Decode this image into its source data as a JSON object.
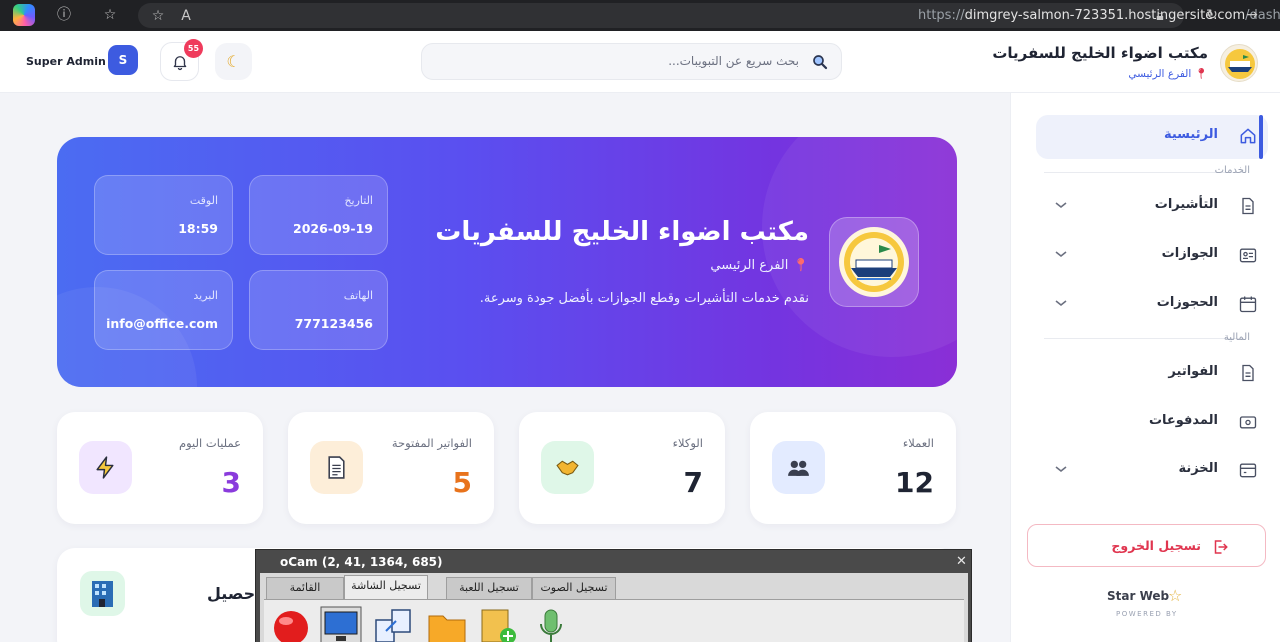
{
  "browser": {
    "url_prefix": "https://",
    "url_host": "dimgrey-salmon-723351.hostingersite.com",
    "url_path": "/dashboard"
  },
  "header": {
    "admin_name": "Super Admin",
    "avatar_letter": "S",
    "notification_count": "55",
    "search_placeholder": "بحث سريع عن التبويبات...",
    "brand_title": "مكتب اضواء الخليج للسفريات",
    "brand_branch": "الفرع الرئيسي"
  },
  "sidebar": {
    "home": "الرئيسية",
    "section_services": "الخدمات",
    "visas": "التأشيرات",
    "passports": "الجوازات",
    "bookings": "الحجوزات",
    "section_finance": "المالية",
    "invoices": "الفواتير",
    "payments": "المدفوعات",
    "treasury": "الخزنة",
    "logout": "تسجيل الخروج",
    "footer_brand": "Star Web",
    "footer_powered": "POWERED BY"
  },
  "hero": {
    "title": "مكتب اضواء الخليج للسفريات",
    "branch": "الفرع الرئيسي",
    "description": "نقدم خدمات التأشيرات وقطع الجوازات بأفضل جودة وسرعة.",
    "date_label": "التاريخ",
    "date_value": "2026-09-19",
    "time_label": "الوقت",
    "time_value": "18:59",
    "phone_label": "الهاتف",
    "phone_value": "777123456",
    "email_label": "البريد",
    "email_value": "info@office.com"
  },
  "stats": [
    {
      "label": "العملاء",
      "value": "12",
      "color": "#1f2433",
      "icon_bg": "#e3ebff"
    },
    {
      "label": "الوكلاء",
      "value": "7",
      "color": "#1f2433",
      "icon_bg": "#dff7e8"
    },
    {
      "label": "الفواتير المفتوحة",
      "value": "5",
      "color": "#e8731c",
      "icon_bg": "#fdeed9"
    },
    {
      "label": "عمليات اليوم",
      "value": "3",
      "color": "#8a3bdc",
      "icon_bg": "#f1e6ff"
    }
  ],
  "bottom_card": {
    "title": "حصيل"
  },
  "ocam": {
    "title": "oCam (2, 41, 1364, 685)",
    "tabs": [
      "تسجيل الصوت",
      "تسجيل اللعبة",
      "تسجيل الشاشة",
      "القائمة"
    ]
  }
}
